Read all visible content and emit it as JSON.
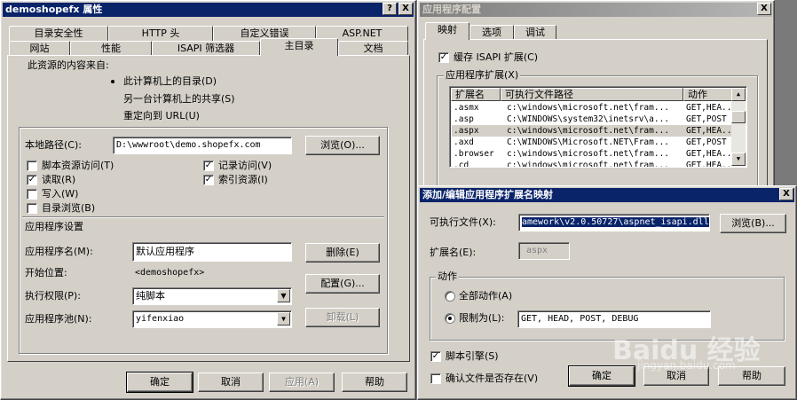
{
  "props": {
    "title": "demoshopefx 属性",
    "help_btn": "?",
    "close_btn": "X",
    "tabs_row1": [
      "目录安全性",
      "HTTP 头",
      "自定义错误",
      "ASP.NET"
    ],
    "tabs_row2": [
      "网站",
      "性能",
      "ISAPI 筛选器",
      "主目录",
      "文档"
    ],
    "content_source_label": "此资源的内容来自:",
    "source_options": [
      "此计算机上的目录(D)",
      "另一台计算机上的共享(S)",
      "重定向到 URL(U)"
    ],
    "local_path_label": "本地路径(C):",
    "local_path_value": "D:\\wwwroot\\demo.shopefx.com",
    "browse_btn": "浏览(O)...",
    "left_checks": [
      {
        "label": "脚本资源访问(T)",
        "checked": false
      },
      {
        "label": "读取(R)",
        "checked": true
      },
      {
        "label": "写入(W)",
        "checked": false
      },
      {
        "label": "目录浏览(B)",
        "checked": false
      }
    ],
    "right_checks": [
      {
        "label": "记录访问(V)",
        "checked": true
      },
      {
        "label": "索引资源(I)",
        "checked": true
      }
    ],
    "app_settings_label": "应用程序设置",
    "app_name_label": "应用程序名(M):",
    "app_name_value": "默认应用程序",
    "remove_btn": "删除(E)",
    "start_point_label": "开始位置:",
    "start_point_value": "<demoshopefx>",
    "config_btn": "配置(G)...",
    "exec_perm_label": "执行权限(P):",
    "exec_perm_value": "纯脚本",
    "app_pool_label": "应用程序池(N):",
    "app_pool_value": "yifenxiao",
    "unload_btn": "卸载(L)",
    "ok_btn": "确定",
    "cancel_btn": "取消",
    "apply_btn": "应用(A)",
    "help_btn2": "帮助"
  },
  "appcfg": {
    "title": "应用程序配置",
    "close_btn": "X",
    "tabs": [
      "映射",
      "选项",
      "调试"
    ],
    "cache_label": "缓存 ISAPI 扩展(C)",
    "cache_checked": true,
    "ext_group_label": "应用程序扩展(X)",
    "columns": [
      "扩展名",
      "可执行文件路径",
      "动作"
    ],
    "rows": [
      {
        "ext": ".asmx",
        "path": "c:\\windows\\microsoft.net\\fram...",
        "verbs": "GET,HEA..."
      },
      {
        "ext": ".asp",
        "path": "C:\\WINDOWS\\system32\\inetsrv\\a...",
        "verbs": "GET,POST"
      },
      {
        "ext": ".aspx",
        "path": "c:\\windows\\microsoft.net\\fram...",
        "verbs": "GET,HEA..."
      },
      {
        "ext": ".axd",
        "path": "C:\\WINDOWS\\Microsoft.NET\\Fram...",
        "verbs": "GET,POST"
      },
      {
        "ext": ".browser",
        "path": "c:\\windows\\microsoft.net\\fram...",
        "verbs": "GET,HEA..."
      },
      {
        "ext": ".cd",
        "path": "c:\\windows\\microsoft.net\\fram...",
        "verbs": "GET,HEA..."
      }
    ]
  },
  "addedit": {
    "title": "添加/编辑应用程序扩展名映射",
    "close_btn": "X",
    "exe_label": "可执行文件(X):",
    "exe_value": "amework\\v2.0.50727\\aspnet_isapi.dll",
    "browse_btn": "浏览(B)...",
    "ext_label": "扩展名(E):",
    "ext_value": "aspx",
    "verbs_group": "动作",
    "all_verbs": "全部动作(A)",
    "limit_to": "限制为(L):",
    "limit_value": "GET, HEAD, POST, DEBUG",
    "script_engine": "脚本引擎(S)",
    "script_engine_checked": true,
    "verify_file": "确认文件是否存在(V)",
    "verify_file_checked": false,
    "ok_btn": "确定",
    "cancel_btn": "取消",
    "help_btn": "帮助"
  },
  "watermark": {
    "brand": "Baidu 经验",
    "url": "jingyan.baidu.com"
  }
}
